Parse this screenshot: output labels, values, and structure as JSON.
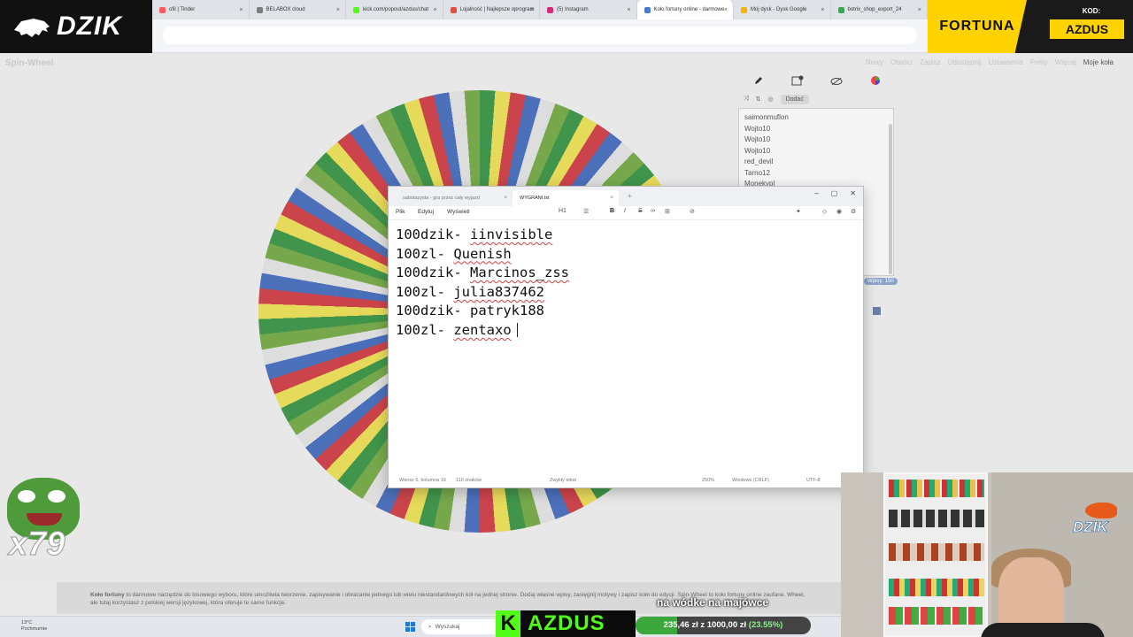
{
  "browser": {
    "tabs": [
      {
        "label": "ofil | Tinder",
        "color": "#ff5a5f"
      },
      {
        "label": "BELABOX cloud",
        "color": "#7d7d7d"
      },
      {
        "label": "kick.com/popout/azdus/chat",
        "color": "#53fc18"
      },
      {
        "label": "Lojalność | Najlepsze oprogram",
        "color": "#e74c3c"
      },
      {
        "label": "(5) Instagram",
        "color": "#d62976"
      },
      {
        "label": "Koło fortuny online - darmowe",
        "color": "#4a7bd0",
        "active": true
      },
      {
        "label": "Mój dysk - Dysk Google",
        "color": "#f4b400"
      },
      {
        "label": "botrix_shop_export_24",
        "color": "#34a853"
      }
    ]
  },
  "logo": {
    "text": "DZIK"
  },
  "ad": {
    "brand": "FORTUNA",
    "code_label": "KOD:",
    "code": "AZDUS"
  },
  "wheel_app": {
    "title": "Spin-Wheel",
    "topnav": [
      "Nowy",
      "Otwórz",
      "Zapisz",
      "Udostępnij",
      "Ustawienia",
      "Pełny",
      "Więcej"
    ],
    "my_wheels": "Moje koła",
    "add_label": "Dodać",
    "entries": [
      "saimonmuflon",
      "Wojto10",
      "Wojto10",
      "Wojto10",
      "red_devil",
      "Tarno12",
      "Monekypl"
    ],
    "badge": "Wpisy: 150"
  },
  "notepad": {
    "tabs": [
      {
        "label": "sabotazysta - gra przez cały wyjazd"
      },
      {
        "label": "WYGRANI.txt"
      }
    ],
    "menu": [
      "Plik",
      "Edytuj",
      "Wyświetl"
    ],
    "heading": "H1",
    "lines": [
      {
        "prefix": "100dzik- ",
        "name": "iinvisible",
        "underline": true
      },
      {
        "prefix": "100zl- ",
        "name": "Quenish",
        "underline": true
      },
      {
        "prefix": "100dzik- ",
        "name": "Marcinos_zss",
        "underline": true
      },
      {
        "prefix": "100zl- ",
        "name": "julia837462",
        "underline": true
      },
      {
        "prefix": "100dzik- ",
        "name": "patryk188",
        "underline": false
      },
      {
        "prefix": "100zl- ",
        "name": "zentaxo",
        "underline": true
      }
    ],
    "status": {
      "position": "Wiersz 6, kolumna 16",
      "chars": "110 znaków",
      "format": "Zwykły tekst",
      "zoom": "250%",
      "line_ending": "Windows (CRLF)",
      "encoding": "UTF-8"
    }
  },
  "description": {
    "lead": "Koło fortuny",
    "text": " to darmowe narzędzie do losowego wyboru, które umożliwia tworzenie, zapisywanie i obracanie jednego lub wielu niestandardowych kół na jednej stronie. Dodaj własne wpisy, zasięgnij motywy i zapisz koło do edycji. Spin-Wheel to koło fortuny online zaufane. Wheel, ale tutaj korzystasz z polskiej wersji językowej, która oferuje te same funkcje."
  },
  "taskbar": {
    "temp": "13°C",
    "weather": "Pochmurnie",
    "search": "Wyszukaj"
  },
  "overlay": {
    "emote_count": "x79",
    "kick_letter": "K",
    "kick_name": "AZDUS",
    "goal_title": "na wódke na majówce",
    "goal_amount": "235,46 zł z 1000,00 zł",
    "goal_percent": "(23.55%)",
    "goal_fraction": 0.2355,
    "cam_brand": "DZIK"
  }
}
